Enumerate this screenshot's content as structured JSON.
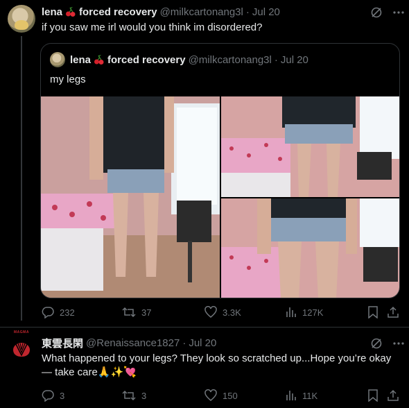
{
  "post1": {
    "display_name": "lena",
    "display_name_suffix": "forced recovery",
    "handle": "@milkcartonang3l",
    "separator": "·",
    "date": "Jul 20",
    "text": "if you saw me irl would you think im disordered?",
    "quote": {
      "display_name": "lena",
      "display_name_suffix": "forced recovery",
      "handle": "@milkcartonang3l",
      "separator": "·",
      "date": "Jul 20",
      "text": "my legs"
    },
    "stats": {
      "replies": "232",
      "reposts": "37",
      "likes": "3.3K",
      "views": "127K"
    }
  },
  "post2": {
    "display_name": "東雲長閑",
    "handle": "@Renaissance1827",
    "separator": "·",
    "date": "Jul 20",
    "text_line1": "What happened to your legs? They look so scratched up...Hope you’re okay",
    "text_line2": "— take care🙏✨💘",
    "avatar_text": "MAGMA",
    "stats": {
      "replies": "3",
      "reposts": "3",
      "likes": "150",
      "views": "11K"
    }
  },
  "colors": {
    "background": "#000000",
    "text": "#e7e9ea",
    "muted": "#71767b",
    "border": "#2f3336"
  }
}
